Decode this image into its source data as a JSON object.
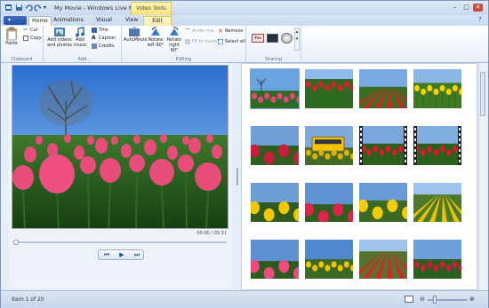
{
  "window": {
    "title": "My Movie - Windows Live Movie Maker"
  },
  "context_tab": "Video Tools",
  "app_menu_label": "▾",
  "tabs": [
    {
      "label": "Home",
      "active": true
    },
    {
      "label": "Animations",
      "active": false
    },
    {
      "label": "Visual Effects",
      "active": false
    },
    {
      "label": "View",
      "active": false
    },
    {
      "label": "Edit",
      "active": false
    }
  ],
  "ribbon": {
    "clipboard": {
      "label": "Clipboard",
      "paste": "Paste",
      "cut": "Cut",
      "copy": "Copy"
    },
    "add": {
      "label": "Add",
      "add_videos": "Add videos and photos",
      "add_music": "Add music",
      "title": "Title",
      "caption": "Caption",
      "credits": "Credits"
    },
    "editing": {
      "label": "Editing",
      "automovie": "AutoMovie",
      "rotate_left": "Rotate left 90°",
      "rotate_right": "Rotate right 90°",
      "audio_mix": "Audio mix",
      "fit_to_music": "Fit to music",
      "remove": "Remove",
      "select_all": "Select all"
    },
    "sharing": {
      "label": "Sharing"
    }
  },
  "preview": {
    "timecode": "00:00 / 03:31",
    "progress": 0
  },
  "status": {
    "text": "Item 1 of 20"
  },
  "colors": {
    "accent": "#2b5ea8",
    "context": "#f3e27a",
    "selection": "#cfe2f8"
  },
  "thumbs": [
    {
      "scene": "tulips-tree",
      "selected": true
    },
    {
      "scene": "red-field"
    },
    {
      "scene": "yellow-red-rows"
    },
    {
      "scene": "yellow-field"
    },
    {
      "scene": "red-closeup"
    },
    {
      "scene": "yellow-bus"
    },
    {
      "scene": "red-tulips-film"
    },
    {
      "scene": "red-tulips-film2"
    },
    {
      "scene": "yellow-closeup"
    },
    {
      "scene": "red-bunch"
    },
    {
      "scene": "yellow-tulip"
    },
    {
      "scene": "rows-field"
    },
    {
      "scene": "pink-tulip"
    },
    {
      "scene": "yellow-sky"
    },
    {
      "scene": "red-rows-field"
    },
    {
      "scene": "red-sky"
    }
  ]
}
